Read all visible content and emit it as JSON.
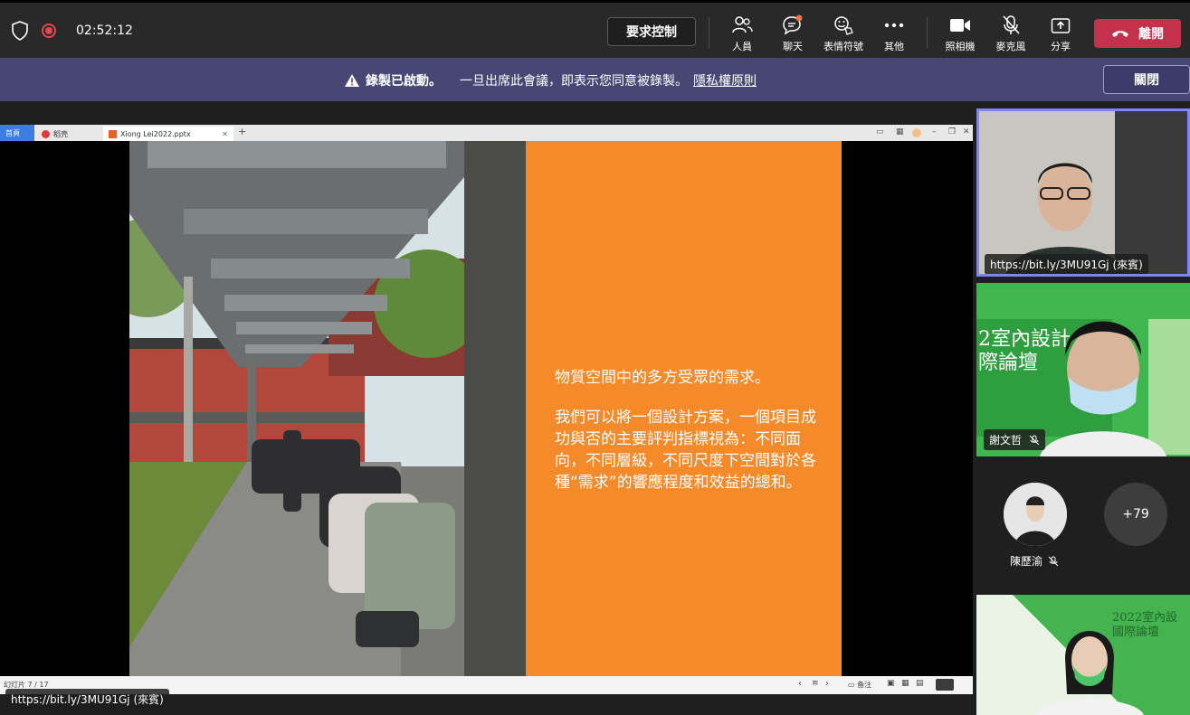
{
  "header": {
    "timer": "02:52:12",
    "request_control": "要求控制",
    "tools": [
      {
        "label": "人員",
        "icon": "people-icon"
      },
      {
        "label": "聊天",
        "icon": "chat-icon"
      },
      {
        "label": "表情符號",
        "icon": "reactions-icon"
      },
      {
        "label": "其他",
        "icon": "more-icon"
      },
      {
        "label": "照相機",
        "icon": "camera-icon"
      },
      {
        "label": "麥克風",
        "icon": "mic-off-icon"
      },
      {
        "label": "分享",
        "icon": "share-icon"
      }
    ],
    "leave": "離開"
  },
  "banner": {
    "recording": "錄製已啟動。",
    "notice": "一旦出席此會議，即表示您同意被錄製。",
    "privacy_link": "隱私權原則",
    "close": "關閉"
  },
  "ppt": {
    "tab_home": "首頁",
    "tab_2": "稻壳",
    "tab_file": "Xiong Lei2022.pptx",
    "slide_status": "幻灯片 7 / 17",
    "notes": "备注",
    "slide_text_1": "物質空間中的多方受眾的需求。",
    "slide_text_2": "我們可以將一個設計方案，一個項目成功與否的主要評判指標視為：不同面向，不同層級，不同尺度下空間對於各種“需求”的響應程度和效益的總和。"
  },
  "presenter_tag": "https://bit.ly/3MU91Gj (來賓)",
  "participants": {
    "tile1_name": "https://bit.ly/3MU91Gj (來賓)",
    "tile2_name": "謝文哲",
    "tile2_bg_text": "2室內設計\n際論壇",
    "avatar_name": "陳歷渝",
    "overflow": "+79",
    "tile3_bg_text": "2022室內設\n國際論壇"
  },
  "colors": {
    "banner": "#464775",
    "leave": "#c4314b",
    "slide_orange": "#f58a2a",
    "active_border": "#7f85f5"
  }
}
